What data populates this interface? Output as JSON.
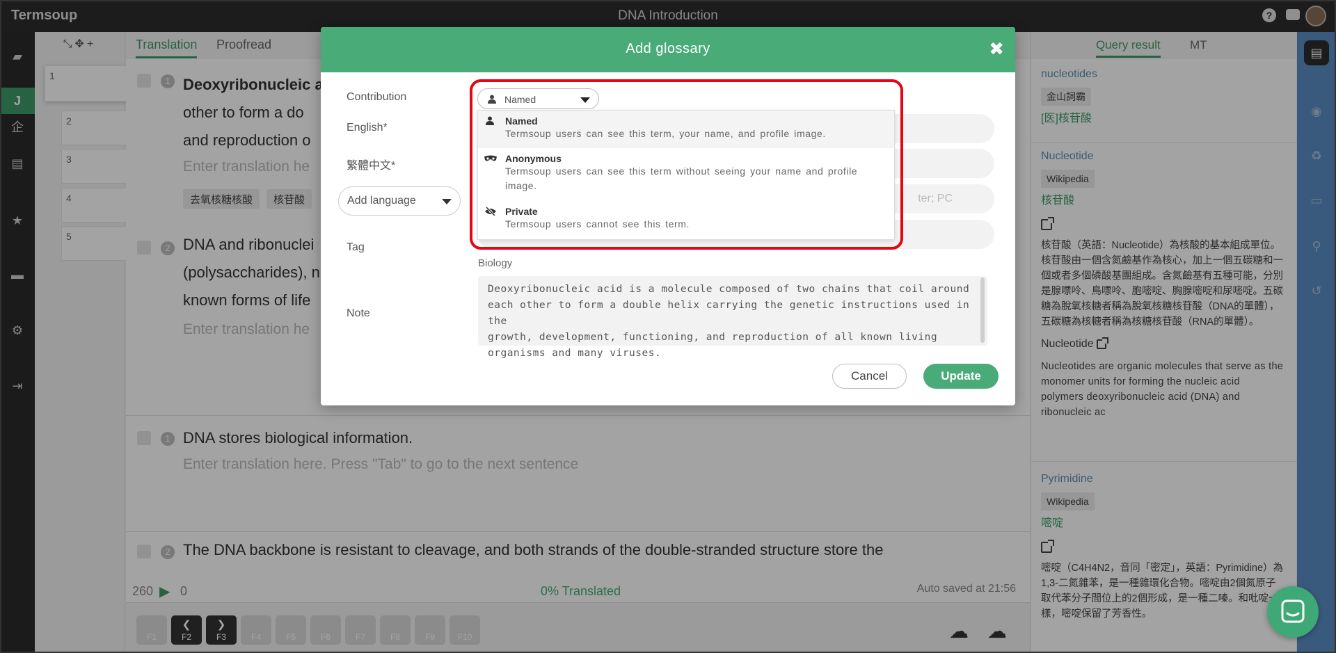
{
  "app": {
    "name": "Termsoup",
    "document_title": "DNA Introduction"
  },
  "left_rail": {
    "active_label": "J",
    "company_label": "企"
  },
  "segments": {
    "tools": "⤡✥+",
    "items": [
      "1",
      "2",
      "3",
      "4",
      "5"
    ]
  },
  "editor": {
    "tabs": [
      "Translation",
      "Proofread"
    ],
    "sentences": [
      {
        "num": "1",
        "lines": [
          "Deoxyribonucleic ac",
          "other to form a do",
          "and reproduction o"
        ],
        "placeholder": "Enter translation he",
        "chips": [
          "去氧核糖核酸",
          "核苷酸"
        ]
      },
      {
        "num": "2",
        "lines": [
          "DNA and ribonuclei",
          "(polysaccharides), n",
          "known forms of life"
        ],
        "placeholder": "Enter translation he"
      },
      {
        "num": "1",
        "lines": [
          "DNA stores biological information."
        ],
        "placeholder": "Enter translation here. Press \"Tab\" to go to the next sentence"
      },
      {
        "num": "2",
        "lines": [
          "The DNA backbone is resistant to cleavage, and both strands of the double-stranded structure store the"
        ]
      }
    ],
    "status": {
      "count": "260",
      "play": "▶",
      "zero": "0",
      "translated": "0% Translated",
      "autosave": "Auto saved at 21:56"
    },
    "fkeys": [
      "F1",
      "F2",
      "F3",
      "F4",
      "F5",
      "F6",
      "F7",
      "F8",
      "F9",
      "F10"
    ]
  },
  "right_panel": {
    "tabs": [
      "Query result",
      "MT"
    ],
    "entries": [
      {
        "head": "nucleotides",
        "source": "金山詞霸",
        "term": "[医]核苷酸"
      },
      {
        "head": "Nucleotide",
        "source": "Wikipedia",
        "term": "核苷酸",
        "body": "核苷酸（英語：Nucleotide）為核酸的基本組成單位。核苷酸由一個含氮鹼基作為核心，加上一個五碳糖和一個或者多個磷酸基團組成。含氮鹼基有五種可能，分別是腺嘌呤、鳥嘌呤、胞嘧啶、胸腺嘧啶和尿嘧啶。五碳糖為脫氧核糖者稱為脫氧核糖核苷酸（DNA的單體），五碳糖為核糖者稱為核糖核苷酸（RNA的單體）。",
        "en_head": "Nucleotide",
        "en_body": "Nucleotides are organic molecules that serve as the monomer units for forming the nucleic acid polymers deoxyribonucleic acid (DNA) and ribonucleic ac"
      },
      {
        "head": "Pyrimidine",
        "source": "Wikipedia",
        "term": "嘧啶",
        "body": "嘧啶（C4H4N2，音同「密定」，英語：Pyrimidine）為1,3-二氮雜苯，是一種雜環化合物。嘧啶由2個氮原子取代苯分子間位上的2個形成，是一種二嗪。和吡啶一樣，嘧啶保留了芳香性。"
      }
    ]
  },
  "modal": {
    "title": "Add glossary",
    "close": "✖",
    "labels": {
      "contribution": "Contribution",
      "english": "English*",
      "chinese": "繁體中文*",
      "tag": "Tag",
      "note": "Note"
    },
    "add_language": "Add language",
    "input_hint": "ter; PC",
    "group_name": "Biology",
    "note_lines": [
      "Deoxyribonucleic acid is a molecule composed of two chains that coil around",
      "each other to form a double helix carrying the genetic instructions used in the",
      "growth, development, functioning, and reproduction of all known living",
      "organisms and many viruses."
    ],
    "cancel": "Cancel",
    "update": "Update"
  },
  "contribution": {
    "selected": "Named",
    "options": [
      {
        "title": "Named",
        "icon": "person-icon",
        "desc": "Termsoup users can see this term, your name, and profile image."
      },
      {
        "title": "Anonymous",
        "icon": "mask-icon",
        "desc": "Termsoup users can see this term without seeing your name and profile image."
      },
      {
        "title": "Private",
        "icon": "eye-slash-icon",
        "desc": "Termsoup users cannot see this term."
      }
    ]
  },
  "colors": {
    "accent": "#48ab78",
    "highlight": "#e30613",
    "rail": "#5b8dc4"
  }
}
